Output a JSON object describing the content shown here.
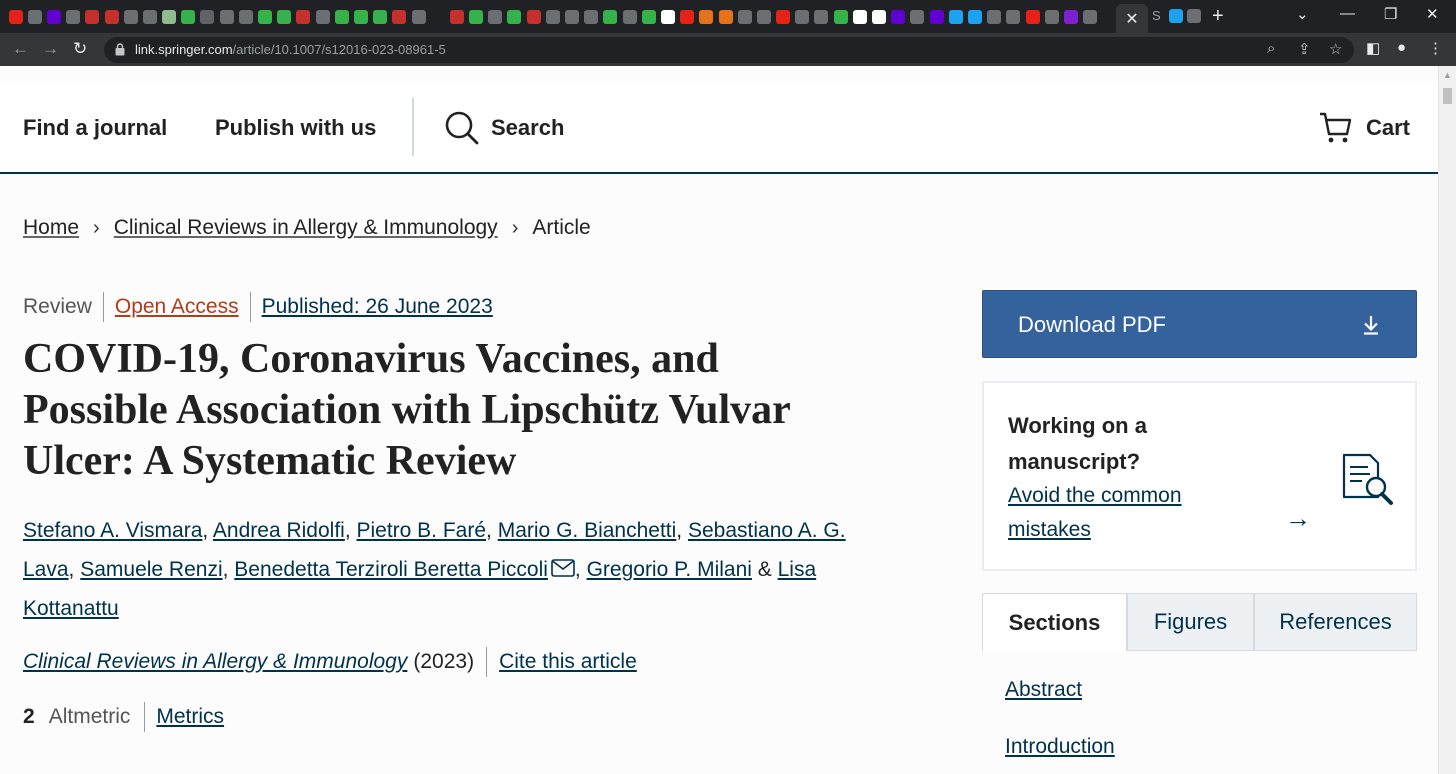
{
  "browser": {
    "url_domain": "link.springer.com",
    "url_path": "/article/10.1007/s12016-023-08961-5",
    "active_tab_close": "✕",
    "new_tab": "+",
    "extra_tab_letter": "S",
    "favicon_colors": [
      "#e62117",
      "#6b6e72",
      "#6001d2",
      "#6b6e72",
      "#c4302b",
      "#c4302b",
      "#6b6e72",
      "#6b6e72",
      "#8fbc8f",
      "#35b34a",
      "#5f6368",
      "#6b6e72",
      "#6b6e72",
      "#35b34a",
      "#35b34a",
      "#c4302b",
      "#6b6e72",
      "#35b34a",
      "#35b34a",
      "#35b34a",
      "#c4302b",
      "#6b6e72",
      "#1f2124",
      "#c4302b",
      "#35b34a",
      "#6b6e72",
      "#35b34a",
      "#c4302b",
      "#6b6e72",
      "#6b6e72",
      "#6b6e72",
      "#35b34a",
      "#6b6e72",
      "#35b34a",
      "#ffffff",
      "#e62117",
      "#e8711c",
      "#e8711c",
      "#6b6e72",
      "#6b6e72",
      "#e62117",
      "#6b6e72",
      "#6b6e72",
      "#35b34a",
      "#ffffff",
      "#ffffff",
      "#6001d2",
      "#6b6e72",
      "#6001d2",
      "#1da1f2",
      "#1da1f2",
      "#6b6e72",
      "#6b6e72",
      "#e62117",
      "#6b6e72",
      "#7e1fd1",
      "#6b6e72"
    ]
  },
  "header": {
    "find_journal": "Find a journal",
    "publish": "Publish with us",
    "search": "Search",
    "cart": "Cart"
  },
  "breadcrumb": {
    "home": "Home",
    "journal": "Clinical Reviews in Allergy & Immunology",
    "current": "Article"
  },
  "article": {
    "type": "Review",
    "open_access": "Open Access",
    "published": "Published: 26 June 2023",
    "title": "COVID-19, Coronavirus Vaccines, and Possible Association with Lipschütz Vulvar Ulcer: A Systematic Review",
    "authors": [
      "Stefano A. Vismara",
      "Andrea Ridolfi",
      "Pietro B. Faré",
      "Mario G. Bianchetti",
      "Sebastiano A. G. Lava",
      "Samuele Renzi",
      "Benedetta Terziroli Beretta Piccoli",
      "Gregorio P. Milani",
      "Lisa Kottanattu"
    ],
    "author_sep": ", ",
    "author_last_sep": " & ",
    "journal_name": "Clinical Reviews in Allergy & Immunology",
    "year": "(2023)",
    "cite": "Cite this article",
    "altmetric_count": "2",
    "altmetric_label": "Altmetric",
    "metrics": "Metrics"
  },
  "sidebar": {
    "download": "Download PDF",
    "manuscript_heading": "Working on a manuscript?",
    "manuscript_link": "Avoid the common mistakes",
    "arrow": "→",
    "tabs": [
      "Sections",
      "Figures",
      "References"
    ],
    "toc": [
      "Abstract",
      "Introduction"
    ]
  }
}
